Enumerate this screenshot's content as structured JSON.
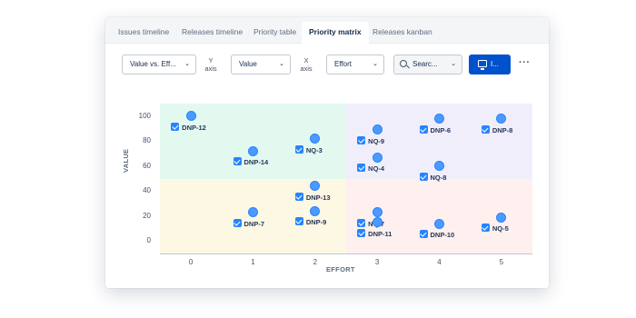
{
  "tabs": [
    {
      "label": "Issues timeline",
      "active": false
    },
    {
      "label": "Releases timeline",
      "active": false
    },
    {
      "label": "Priority table",
      "active": false
    },
    {
      "label": "Priority matrix",
      "active": true
    },
    {
      "label": "Releases kanban",
      "active": false
    }
  ],
  "toolbar": {
    "preset_select": "Value vs. Eff...",
    "y_axis_label_1": "Y",
    "y_axis_label_2": "axis",
    "y_axis_select": "Value",
    "x_axis_label_1": "X",
    "x_axis_label_2": "axis",
    "x_axis_select": "Effort",
    "search_label": "Searc...",
    "primary_button": "I...",
    "more_label": "···"
  },
  "colors": {
    "accent": "#0052cc",
    "dot": "#4c9aff",
    "checkbox": "#2684ff",
    "quad_top_left": "#e3f9f0",
    "quad_top_right": "#f1eefc",
    "quad_bottom_left": "#fdf8e3",
    "quad_bottom_right": "#fdf0ee"
  },
  "chart_data": {
    "type": "scatter",
    "xlabel": "EFFORT",
    "ylabel": "VALUE",
    "xlim": [
      -0.5,
      5.5
    ],
    "ylim": [
      -10,
      110
    ],
    "x_ticks": [
      "0",
      "1",
      "2",
      "3",
      "4",
      "5"
    ],
    "y_ticks": [
      "0",
      "20",
      "40",
      "60",
      "80",
      "100"
    ],
    "grid": false,
    "quadrant_split": {
      "x": 2.5,
      "y": 50
    },
    "points": [
      {
        "id": "DNP-12",
        "x": 0,
        "y": 100
      },
      {
        "id": "DNP-14",
        "x": 1,
        "y": 72
      },
      {
        "id": "DNP-7",
        "x": 1,
        "y": 23
      },
      {
        "id": "NQ-3",
        "x": 2,
        "y": 82
      },
      {
        "id": "DNP-13",
        "x": 2,
        "y": 44
      },
      {
        "id": "DNP-9",
        "x": 2,
        "y": 24
      },
      {
        "id": "NQ-9",
        "x": 3,
        "y": 89
      },
      {
        "id": "NQ-4",
        "x": 3,
        "y": 67
      },
      {
        "id": "NQ-7",
        "x": 3,
        "y": 23
      },
      {
        "id": "DNP-11",
        "x": 3,
        "y": 15
      },
      {
        "id": "DNP-6",
        "x": 4,
        "y": 98
      },
      {
        "id": "NQ-8",
        "x": 4,
        "y": 60
      },
      {
        "id": "DNP-10",
        "x": 4,
        "y": 14
      },
      {
        "id": "DNP-8",
        "x": 5,
        "y": 98
      },
      {
        "id": "NQ-5",
        "x": 5,
        "y": 19
      }
    ]
  }
}
